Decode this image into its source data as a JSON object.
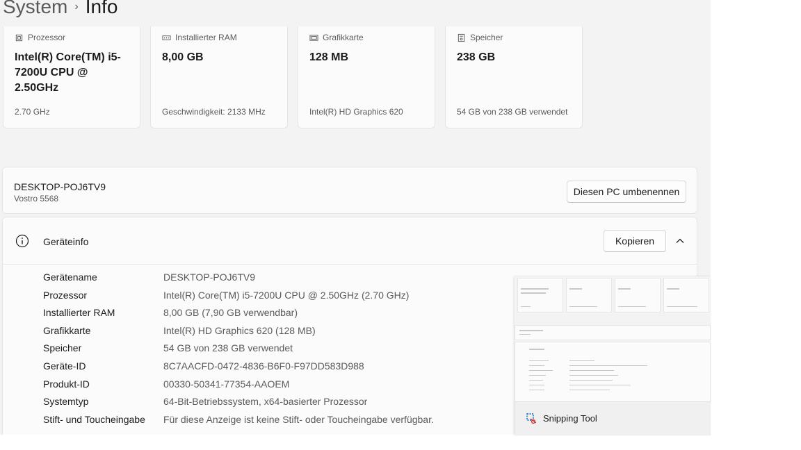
{
  "breadcrumb": {
    "parent": "System",
    "separator": "›",
    "current": "Info"
  },
  "specs": [
    {
      "icon": "cpu-icon",
      "label": "Prozessor",
      "value": "Intel(R) Core(TM) i5-7200U CPU @ 2.50GHz",
      "sub": "2.70 GHz"
    },
    {
      "icon": "ram-icon",
      "label": "Installierter RAM",
      "value": "8,00 GB",
      "sub": "Geschwindigkeit: 2133 MHz"
    },
    {
      "icon": "gpu-icon",
      "label": "Grafikkarte",
      "value": "128 MB",
      "sub": "Intel(R) HD Graphics 620"
    },
    {
      "icon": "storage-icon",
      "label": "Speicher",
      "value": "238 GB",
      "sub": "54 GB von 238 GB verwendet"
    }
  ],
  "pc": {
    "name": "DESKTOP-POJ6TV9",
    "model": "Vostro 5568",
    "rename_label": "Diesen PC umbenennen"
  },
  "device_info": {
    "title": "Geräteinfo",
    "copy_label": "Kopieren",
    "rows": [
      {
        "key": "Gerätename",
        "value": "DESKTOP-POJ6TV9"
      },
      {
        "key": "Prozessor",
        "value": "Intel(R) Core(TM) i5-7200U CPU @ 2.50GHz (2.70 GHz)"
      },
      {
        "key": "Installierter RAM",
        "value": "8,00 GB (7,90 GB verwendbar)"
      },
      {
        "key": "Grafikkarte",
        "value": "Intel(R) HD Graphics 620 (128 MB)"
      },
      {
        "key": "Speicher",
        "value": "54 GB von 238 GB verwendet"
      },
      {
        "key": "Geräte-ID",
        "value": "8C7AACFD-0472-4836-B6F0-F97DD583D988"
      },
      {
        "key": "Produkt-ID",
        "value": "00330-50341-77354-AAOEM"
      },
      {
        "key": "Systemtyp",
        "value": "64-Bit-Betriebssystem, x64-basierter Prozessor"
      },
      {
        "key": "Stift- und Toucheingabe",
        "value": "Für diese Anzeige ist keine Stift- oder Toucheingabe verfügbar."
      }
    ]
  },
  "snipping_tool": {
    "label": "Snipping Tool"
  }
}
